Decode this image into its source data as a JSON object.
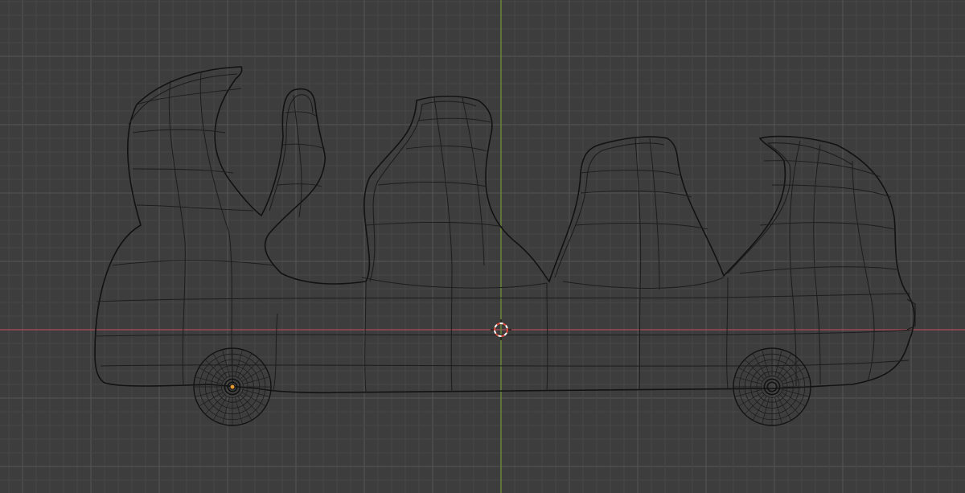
{
  "viewport": {
    "view": "front-orthographic-wireframe",
    "background_color": "#3d3d3d",
    "grid_minor_color": "#474747",
    "grid_major_color": "#555555",
    "x_axis_color": "#9b4a55",
    "z_axis_color": "#6f8a3a",
    "wire_color": "#1d1d1d",
    "outline_color": "#121212",
    "origin_color": "#e69a34",
    "cursor_color_primary": "#d94a3a",
    "cursor_color_secondary": "#ffffff"
  },
  "scene": {
    "objects": [
      {
        "name": "coaster-car-body",
        "type": "mesh",
        "selected": false
      },
      {
        "name": "front-wheel",
        "type": "mesh",
        "selected": false
      },
      {
        "name": "rear-wheel",
        "type": "mesh",
        "selected": false
      }
    ],
    "cursor_icon": "3d-cursor-icon",
    "origin_icon": "object-origin-icon"
  }
}
